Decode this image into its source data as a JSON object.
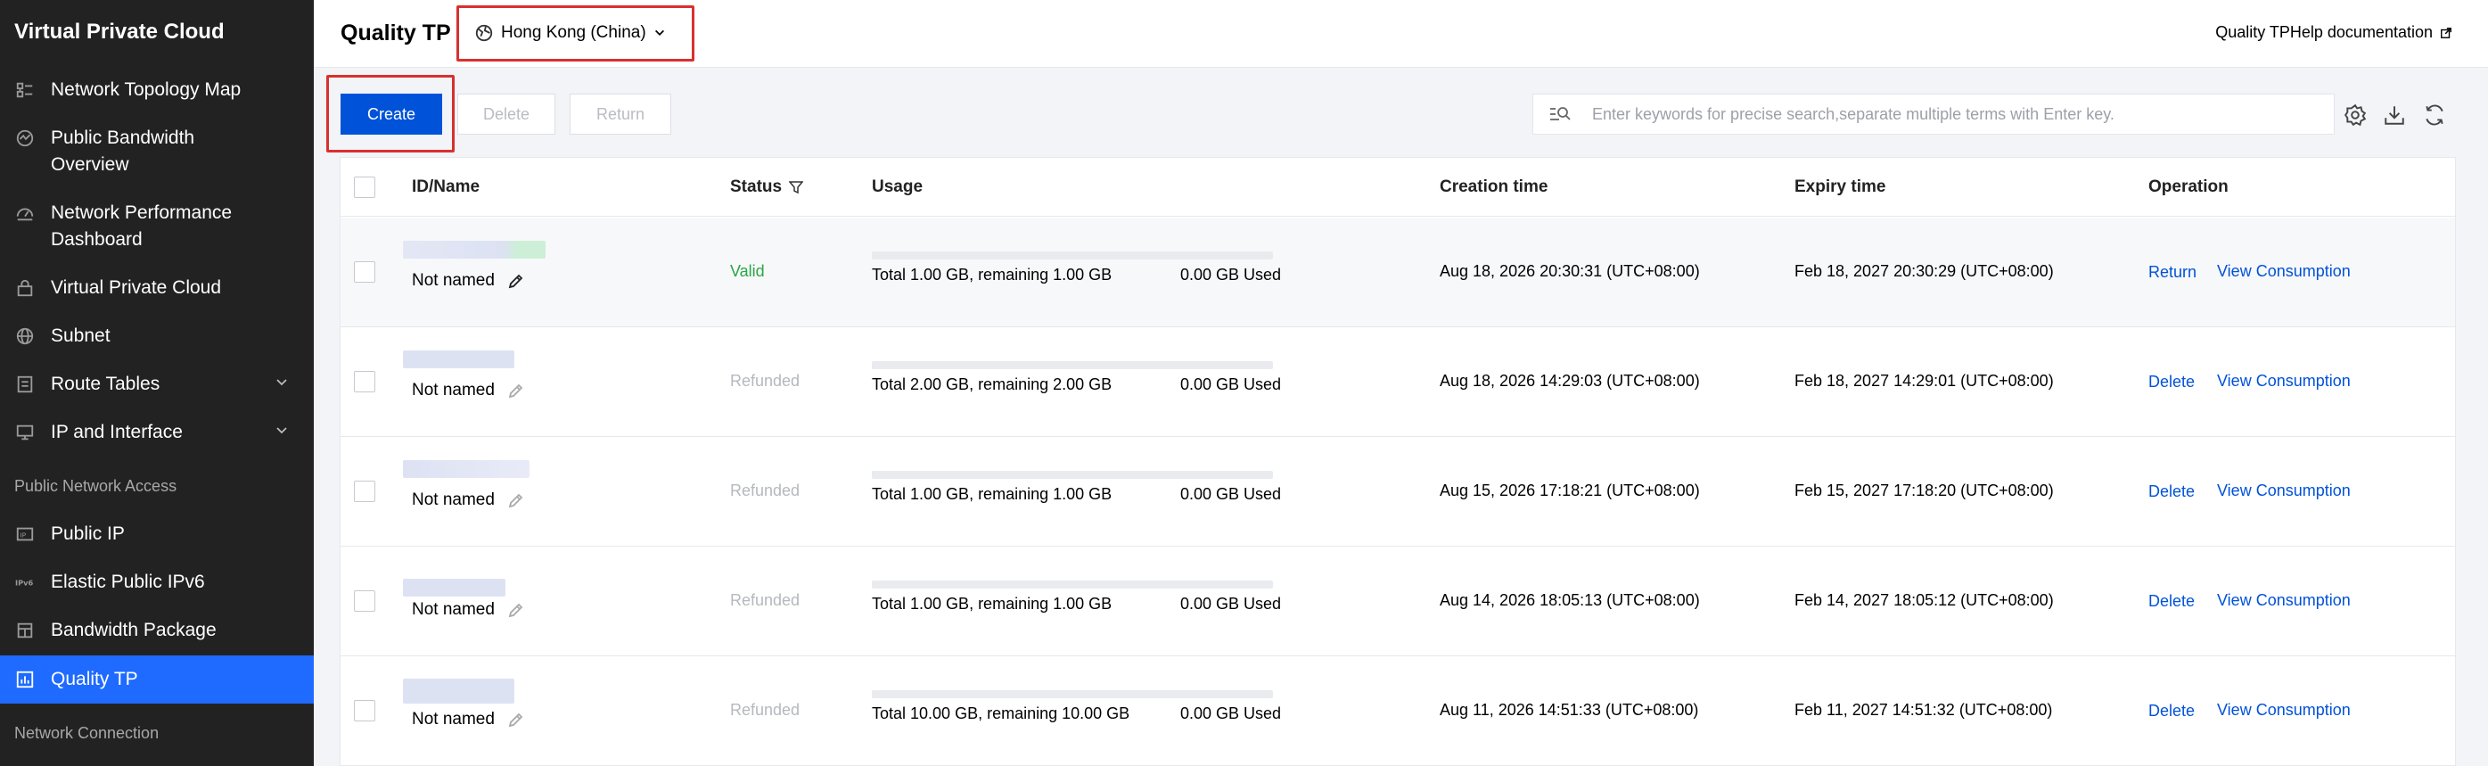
{
  "sidebar": {
    "title": "Virtual Private Cloud",
    "items": [
      {
        "label": "Network Topology Map",
        "icon": "topology-icon"
      },
      {
        "label": "Public Bandwidth Overview",
        "icon": "bandwidth-overview-icon"
      },
      {
        "label": "Network Performance Dashboard",
        "icon": "dashboard-icon"
      },
      {
        "label": "Virtual Private Cloud",
        "icon": "lock-icon"
      },
      {
        "label": "Subnet",
        "icon": "globe-icon"
      },
      {
        "label": "Route Tables",
        "icon": "route-table-icon",
        "expandable": true
      },
      {
        "label": "IP and Interface",
        "icon": "ip-interface-icon",
        "expandable": true
      }
    ],
    "section_public": "Public Network Access",
    "public_items": [
      {
        "label": "Public IP",
        "icon": "public-ip-icon"
      },
      {
        "label": "Elastic Public IPv6",
        "icon": "ipv6-icon"
      },
      {
        "label": "Bandwidth Package",
        "icon": "bandwidth-package-icon"
      },
      {
        "label": "Quality TP",
        "icon": "chart-icon",
        "active": true
      }
    ],
    "section_connection": "Network Connection"
  },
  "header": {
    "title": "Quality TP",
    "region": "Hong Kong (China)",
    "help_link": "Quality TPHelp documentation"
  },
  "toolbar": {
    "create_label": "Create",
    "delete_label": "Delete",
    "return_label": "Return",
    "search_placeholder": "Enter keywords for precise search,separate multiple terms with Enter key."
  },
  "table": {
    "columns": {
      "id_name": "ID/Name",
      "status": "Status",
      "usage": "Usage",
      "creation_time": "Creation time",
      "expiry_time": "Expiry time",
      "operation": "Operation"
    },
    "rows": [
      {
        "name": "Not named",
        "status": "Valid",
        "usage": "Total 1.00 GB, remaining 1.00 GB",
        "used": "0.00 GB Used",
        "created": "Aug 18, 2026 20:30:31 (UTC+08:00)",
        "expires": "Feb 18, 2027 20:30:29 (UTC+08:00)",
        "op1": "Return",
        "op2": "View Consumption"
      },
      {
        "name": "Not named",
        "status": "Refunded",
        "usage": "Total 2.00 GB, remaining 2.00 GB",
        "used": "0.00 GB Used",
        "created": "Aug 18, 2026 14:29:03 (UTC+08:00)",
        "expires": "Feb 18, 2027 14:29:01 (UTC+08:00)",
        "op1": "Delete",
        "op2": "View Consumption"
      },
      {
        "name": "Not named",
        "status": "Refunded",
        "usage": "Total 1.00 GB, remaining 1.00 GB",
        "used": "0.00 GB Used",
        "created": "Aug 15, 2026 17:18:21 (UTC+08:00)",
        "expires": "Feb 15, 2027 17:18:20 (UTC+08:00)",
        "op1": "Delete",
        "op2": "View Consumption"
      },
      {
        "name": "Not named",
        "status": "Refunded",
        "usage": "Total 1.00 GB, remaining 1.00 GB",
        "used": "0.00 GB Used",
        "created": "Aug 14, 2026 18:05:13 (UTC+08:00)",
        "expires": "Feb 14, 2027 18:05:12 (UTC+08:00)",
        "op1": "Delete",
        "op2": "View Consumption"
      },
      {
        "name": "Not named",
        "status": "Refunded",
        "usage": "Total 10.00 GB, remaining 10.00 GB",
        "used": "0.00 GB Used",
        "created": "Aug 11, 2026 14:51:33 (UTC+08:00)",
        "expires": "Feb 11, 2027 14:51:32 (UTC+08:00)",
        "op1": "Delete",
        "op2": "View Consumption"
      }
    ]
  },
  "colors": {
    "accent": "#0052d9",
    "active_nav": "#1f6bff",
    "valid": "#29a744",
    "refunded": "#b5b8be",
    "highlight": "#d9302f"
  }
}
